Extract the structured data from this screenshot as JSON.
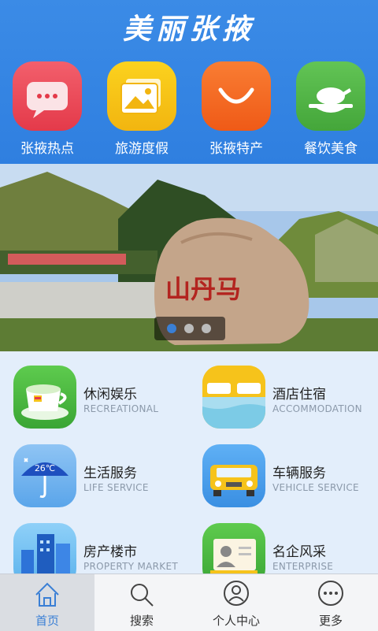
{
  "header": {
    "title": "美丽张掖"
  },
  "categories": [
    {
      "label": "张掖热点",
      "icon": "chat-bubble-icon",
      "color": "#ee4d5c"
    },
    {
      "label": "旅游度假",
      "icon": "photo-icon",
      "color": "#f6c31b"
    },
    {
      "label": "张掖特产",
      "icon": "smile-bag-icon",
      "color": "#f56b22"
    },
    {
      "label": "餐饮美食",
      "icon": "roast-chicken-icon",
      "color": "#52b545"
    }
  ],
  "banner": {
    "carved_text": "山丹马",
    "slide_count": 3,
    "active_slide": 1
  },
  "services": [
    {
      "title": "休闲娱乐",
      "subtitle": "RECREATIONAL",
      "icon": "tea-cup-icon"
    },
    {
      "title": "酒店住宿",
      "subtitle": "ACCOMMODATION",
      "icon": "bed-icon"
    },
    {
      "title": "生活服务",
      "subtitle": "LIFE SERVICE",
      "icon": "umbrella-weather-icon",
      "badge": "26℃"
    },
    {
      "title": "车辆服务",
      "subtitle": "VEHICLE SERVICE",
      "icon": "car-icon"
    },
    {
      "title": "房产楼市",
      "subtitle": "PROPERTY MARKET",
      "icon": "building-icon"
    },
    {
      "title": "名企风采",
      "subtitle": "ENTERPRISE",
      "icon": "id-card-icon"
    }
  ],
  "tabbar": {
    "items": [
      {
        "label": "首页",
        "icon": "home-icon",
        "active": true
      },
      {
        "label": "搜索",
        "icon": "search-icon"
      },
      {
        "label": "个人中心",
        "icon": "user-icon"
      },
      {
        "label": "更多",
        "icon": "more-icon"
      }
    ],
    "active_color": "#3a7fd5"
  }
}
